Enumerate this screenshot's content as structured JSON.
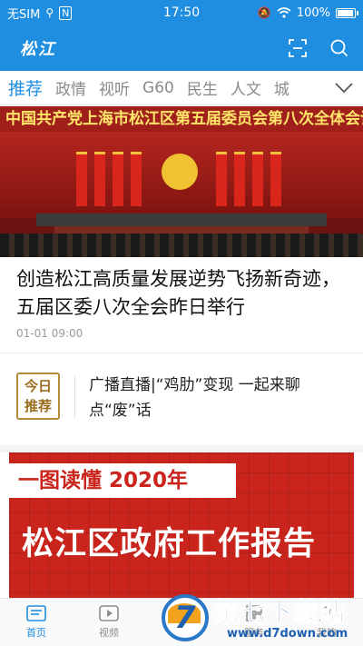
{
  "status_bar": {
    "carrier": "无SIM",
    "time": "17:50",
    "battery": "100%",
    "battery_level": 1.0
  },
  "header": {
    "logo": "松江",
    "icons": [
      "scan-icon",
      "search-icon"
    ]
  },
  "tabs": [
    {
      "label": "推荐",
      "active": true
    },
    {
      "label": "政情",
      "active": false
    },
    {
      "label": "视听",
      "active": false
    },
    {
      "label": "G60",
      "active": false
    },
    {
      "label": "民生",
      "active": false
    },
    {
      "label": "人文",
      "active": false
    },
    {
      "label": "城",
      "active": false
    }
  ],
  "hero": {
    "banner_text": "中国共产党上海市松江区第五届委员会第八次全体会议"
  },
  "headline": {
    "title": "创造松江高质量发展逆势飞扬新奇迹，五届区委八次全会昨日举行",
    "time": "01-01 09:00"
  },
  "today": {
    "badge_line1": "今日",
    "badge_line2": "推荐",
    "text": "广播直播|“鸡肋”变现  一起来聊点“废”话"
  },
  "report": {
    "tag": "一图读懂 2020年",
    "title": "松江区政府工作报告"
  },
  "bottom_nav": [
    {
      "label": "首页",
      "icon": "news-icon",
      "active": true
    },
    {
      "label": "视频",
      "icon": "play-icon",
      "active": false
    },
    {
      "label": "融媒",
      "icon": "media-icon",
      "active": false
    },
    {
      "label": "服务",
      "icon": "grid-icon",
      "active": false
    },
    {
      "label": "我的",
      "icon": "user-icon",
      "active": false
    }
  ],
  "watermark": {
    "name": "第七下载站",
    "url": "www.d7down.com"
  },
  "colors": {
    "brand_blue": "#1f8ee0",
    "report_red": "#c9251d",
    "badge_gold": "#b5893a"
  }
}
